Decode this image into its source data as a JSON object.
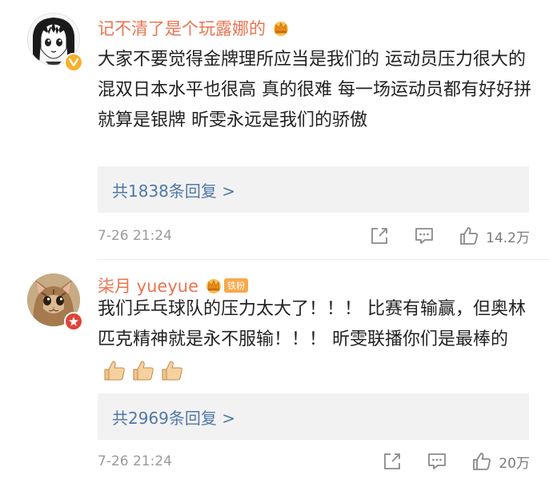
{
  "comments": [
    {
      "username": "记不清了是个玩露娜的",
      "avatar_icon": "anime-girl-avatar",
      "avatar_badge_icon": "verified-v-badge",
      "text": "大家不要觉得金牌理所应当是我们的 运动员压力很大的 混双日本水平也很高 真的很难 每一场运动员都有好好拼 就算是银牌 昕雯永远是我们的骄傲",
      "replies": "共1838条回复 >",
      "time": "7-26 21:24",
      "likes": "14.2万"
    },
    {
      "username": "柒月 yueyue",
      "fan_badge": "铁粉",
      "avatar_icon": "cat-avatar",
      "avatar_badge_icon": "member-badge",
      "text": "我们乒乓球队的压力太大了！！！ 比赛有输赢，但奥林匹克精神就是永不服输！！！ 昕雯联播你们是最棒的",
      "replies": "共2969条回复 >",
      "time": "7-26 21:24",
      "likes": "20万"
    }
  ],
  "colors": {
    "username": "#eb7350",
    "reply_link": "#4f78a8",
    "reply_bg": "#f2f2f2",
    "meta_gray": "#9a9a9a"
  }
}
